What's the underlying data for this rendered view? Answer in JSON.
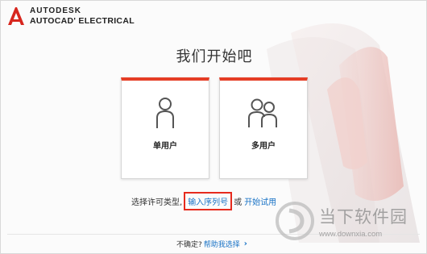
{
  "brand": {
    "company": "AUTODESK",
    "product": "AUTOCAD' ELECTRICAL"
  },
  "main": {
    "title": "我们开始吧",
    "cards": [
      {
        "label": "单用户",
        "icon": "single-user-icon"
      },
      {
        "label": "多用户",
        "icon": "multi-user-icon"
      }
    ],
    "license_prompt": "选择许可类型,",
    "serial_link": "输入序列号",
    "or_text": "或",
    "trial_link": "开始试用"
  },
  "footer": {
    "unsure_text": "不确定?",
    "help_link": "帮助我选择",
    "chevron": "›"
  },
  "watermark": {
    "title": "当下软件园",
    "url": "www.downxia.com"
  },
  "colors": {
    "accent": "#e53d25",
    "link": "#1a73c6",
    "highlight_box": "#e62b1e"
  }
}
